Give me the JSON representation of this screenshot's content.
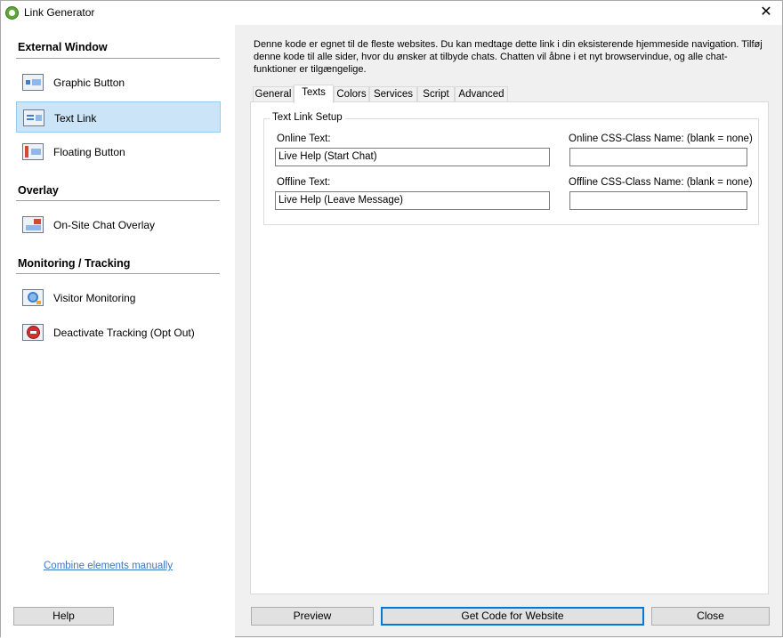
{
  "window": {
    "title": "Link Generator"
  },
  "sidebar": {
    "sections": [
      {
        "header": "External Window",
        "items": [
          {
            "label": "Graphic Button",
            "icon": "graphic-button-icon",
            "selected": false
          },
          {
            "label": "Text Link",
            "icon": "text-link-icon",
            "selected": true
          },
          {
            "label": "Floating Button",
            "icon": "floating-button-icon",
            "selected": false
          }
        ]
      },
      {
        "header": "Overlay",
        "items": [
          {
            "label": "On-Site Chat Overlay",
            "icon": "chat-overlay-icon",
            "selected": false
          }
        ]
      },
      {
        "header": "Monitoring / Tracking",
        "items": [
          {
            "label": "Visitor Monitoring",
            "icon": "visitor-monitoring-icon",
            "selected": false
          },
          {
            "label": "Deactivate Tracking (Opt Out)",
            "icon": "opt-out-icon",
            "selected": false
          }
        ]
      }
    ],
    "combine_link": "Combine elements manually",
    "help_label": "Help"
  },
  "main": {
    "description": "Denne kode er egnet til de fleste websites. Du kan medtage dette link i din eksisterende hjemmeside navigation. Tilføj denne kode til alle sider, hvor du ønsker at tilbyde chats. Chatten vil åbne i et nyt browservindue, og alle chat-funktioner er tilgængelige.",
    "tabs": [
      "General",
      "Texts",
      "Colors",
      "Services",
      "Script",
      "Advanced"
    ],
    "active_tab": "Texts",
    "group_title": "Text Link Setup",
    "online_text_label": "Online Text:",
    "online_text_value": "Live Help (Start Chat)",
    "online_css_label": "Online CSS-Class Name: (blank = none)",
    "online_css_value": "",
    "offline_text_label": "Offline Text:",
    "offline_text_value": "Live Help (Leave Message)",
    "offline_css_label": "Offline CSS-Class Name: (blank = none)",
    "offline_css_value": ""
  },
  "footer": {
    "preview_label": "Preview",
    "get_code_label": "Get Code for Website",
    "close_label": "Close"
  },
  "colors": {
    "selected_bg": "#cce4f7",
    "accent": "#0078d7",
    "link": "#3b78c8"
  }
}
